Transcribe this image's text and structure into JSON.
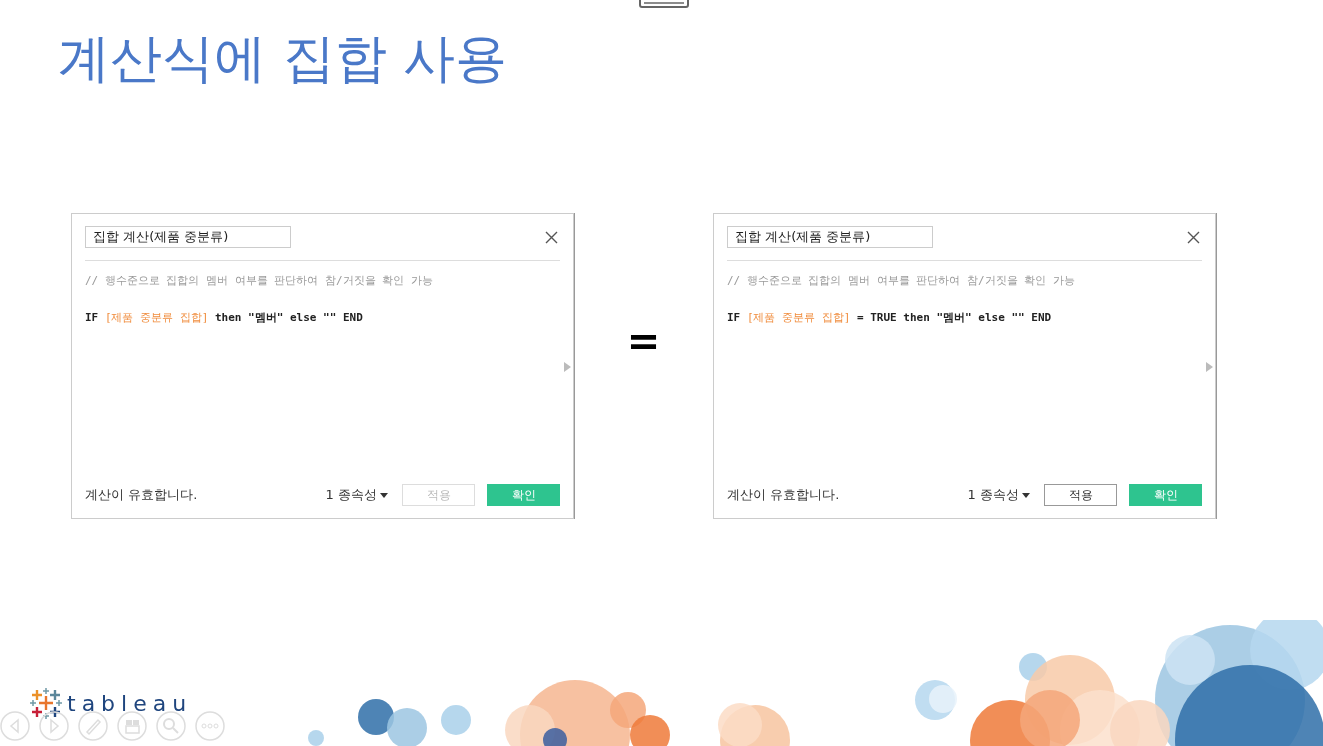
{
  "slide": {
    "title": "계산식에 집합 사용",
    "operator": "=",
    "logo": "tableau"
  },
  "dialogs": [
    {
      "name": "집합 계산(제품 중분류)",
      "comment": "// 행수준으로 집합의 멤버 여부를 판단하여 참/거짓을 확인 가능",
      "formula": [
        {
          "kind": "code",
          "text": "IF "
        },
        {
          "kind": "field",
          "text": "[제품 중분류 집합]"
        },
        {
          "kind": "code",
          "text": " then \"멤버\" else \"\" END"
        }
      ],
      "status": "계산이 유효합니다.",
      "dependency": "1 종속성",
      "apply": {
        "label": "적용",
        "disabled": true
      },
      "ok": "확인"
    },
    {
      "name": "집합 계산(제품 중분류)",
      "comment": "// 행수준으로 집합의 멤버 여부를 판단하여 참/거짓을 확인 가능",
      "formula": [
        {
          "kind": "code",
          "text": "IF "
        },
        {
          "kind": "field",
          "text": "[제품 중분류 집합]"
        },
        {
          "kind": "code",
          "text": " = TRUE then \"멤버\" else \"\" END"
        }
      ],
      "status": "계산이 유효합니다.",
      "dependency": "1 종속성",
      "apply": {
        "label": "적용",
        "disabled": false
      },
      "ok": "확인"
    }
  ]
}
